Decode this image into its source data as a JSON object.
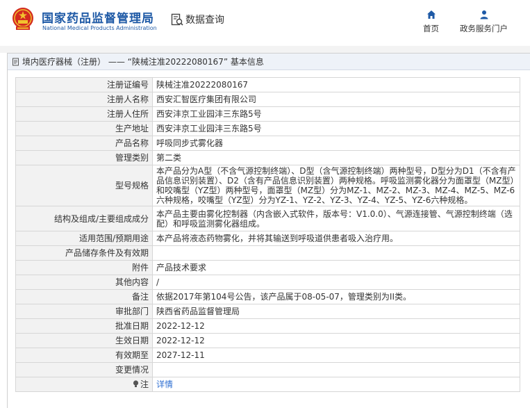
{
  "header": {
    "site_title_cn": "国家药品监督管理局",
    "site_title_en": "National Medical Products Administration",
    "query_label": "数据查询",
    "nav": [
      {
        "label": "首页",
        "icon": "home-icon"
      },
      {
        "label": "政务服务门户",
        "icon": "user-icon"
      }
    ]
  },
  "panel": {
    "title": "境内医疗器械（注册） —— “陕械注准20222080167” 基本信息"
  },
  "rows": [
    {
      "label": "注册证编号",
      "value": "陕械注准20222080167"
    },
    {
      "label": "注册人名称",
      "value": "西安汇智医疗集团有限公司"
    },
    {
      "label": "注册人住所",
      "value": "西安沣京工业园沣三东路5号"
    },
    {
      "label": "生产地址",
      "value": "西安沣京工业园沣三东路5号"
    },
    {
      "label": "产品名称",
      "value": "呼吸同步式雾化器"
    },
    {
      "label": "管理类别",
      "value": "第二类"
    },
    {
      "label": "型号规格",
      "value": "本产品分为A型（不含气源控制终端）、D型（含气源控制终端）两种型号，D型分为D1（不含有产品信息识别装置）、D2（含有产品信息识别装置）两种规格。呼吸监测雾化器分为面罩型（MZ型）和咬嘴型（YZ型）两种型号，面罩型（MZ型）分为MZ-1、MZ-2、MZ-3、MZ-4、MZ-5、MZ-6六种规格，咬嘴型（YZ型）分为YZ-1、YZ-2、YZ-3、YZ-4、YZ-5、YZ-6六种规格。"
    },
    {
      "label": "结构及组成/主要组成成分",
      "value": "本产品主要由雾化控制器（内含嵌入式软件，版本号：V1.0.0）、气源连接管、气源控制终端（选配）和呼吸监测雾化器组成。"
    },
    {
      "label": "适用范围/预期用途",
      "value": "本产品将液态药物雾化，并将其输送到呼吸道供患者吸入治疗用。"
    },
    {
      "label": "产品储存条件及有效期",
      "value": ""
    },
    {
      "label": "附件",
      "value": "产品技术要求"
    },
    {
      "label": "其他内容",
      "value": "/"
    },
    {
      "label": "备注",
      "value": "依据2017年第104号公告，该产品属于08-05-07，管理类别为II类。"
    },
    {
      "label": "审批部门",
      "value": "陕西省药品监督管理局"
    },
    {
      "label": "批准日期",
      "value": "2022-12-12"
    },
    {
      "label": "生效日期",
      "value": "2022-12-12"
    },
    {
      "label": "有效期至",
      "value": "2027-12-11"
    },
    {
      "label": "变更情况",
      "value": ""
    },
    {
      "label": "注",
      "value": "详情",
      "icon": "bulb-icon"
    }
  ],
  "colors": {
    "brand_blue": "#1f5aa6",
    "link_blue": "#2f6fd1",
    "label_bg": "#f2f2f2",
    "title_bg": "#eef2f8"
  }
}
